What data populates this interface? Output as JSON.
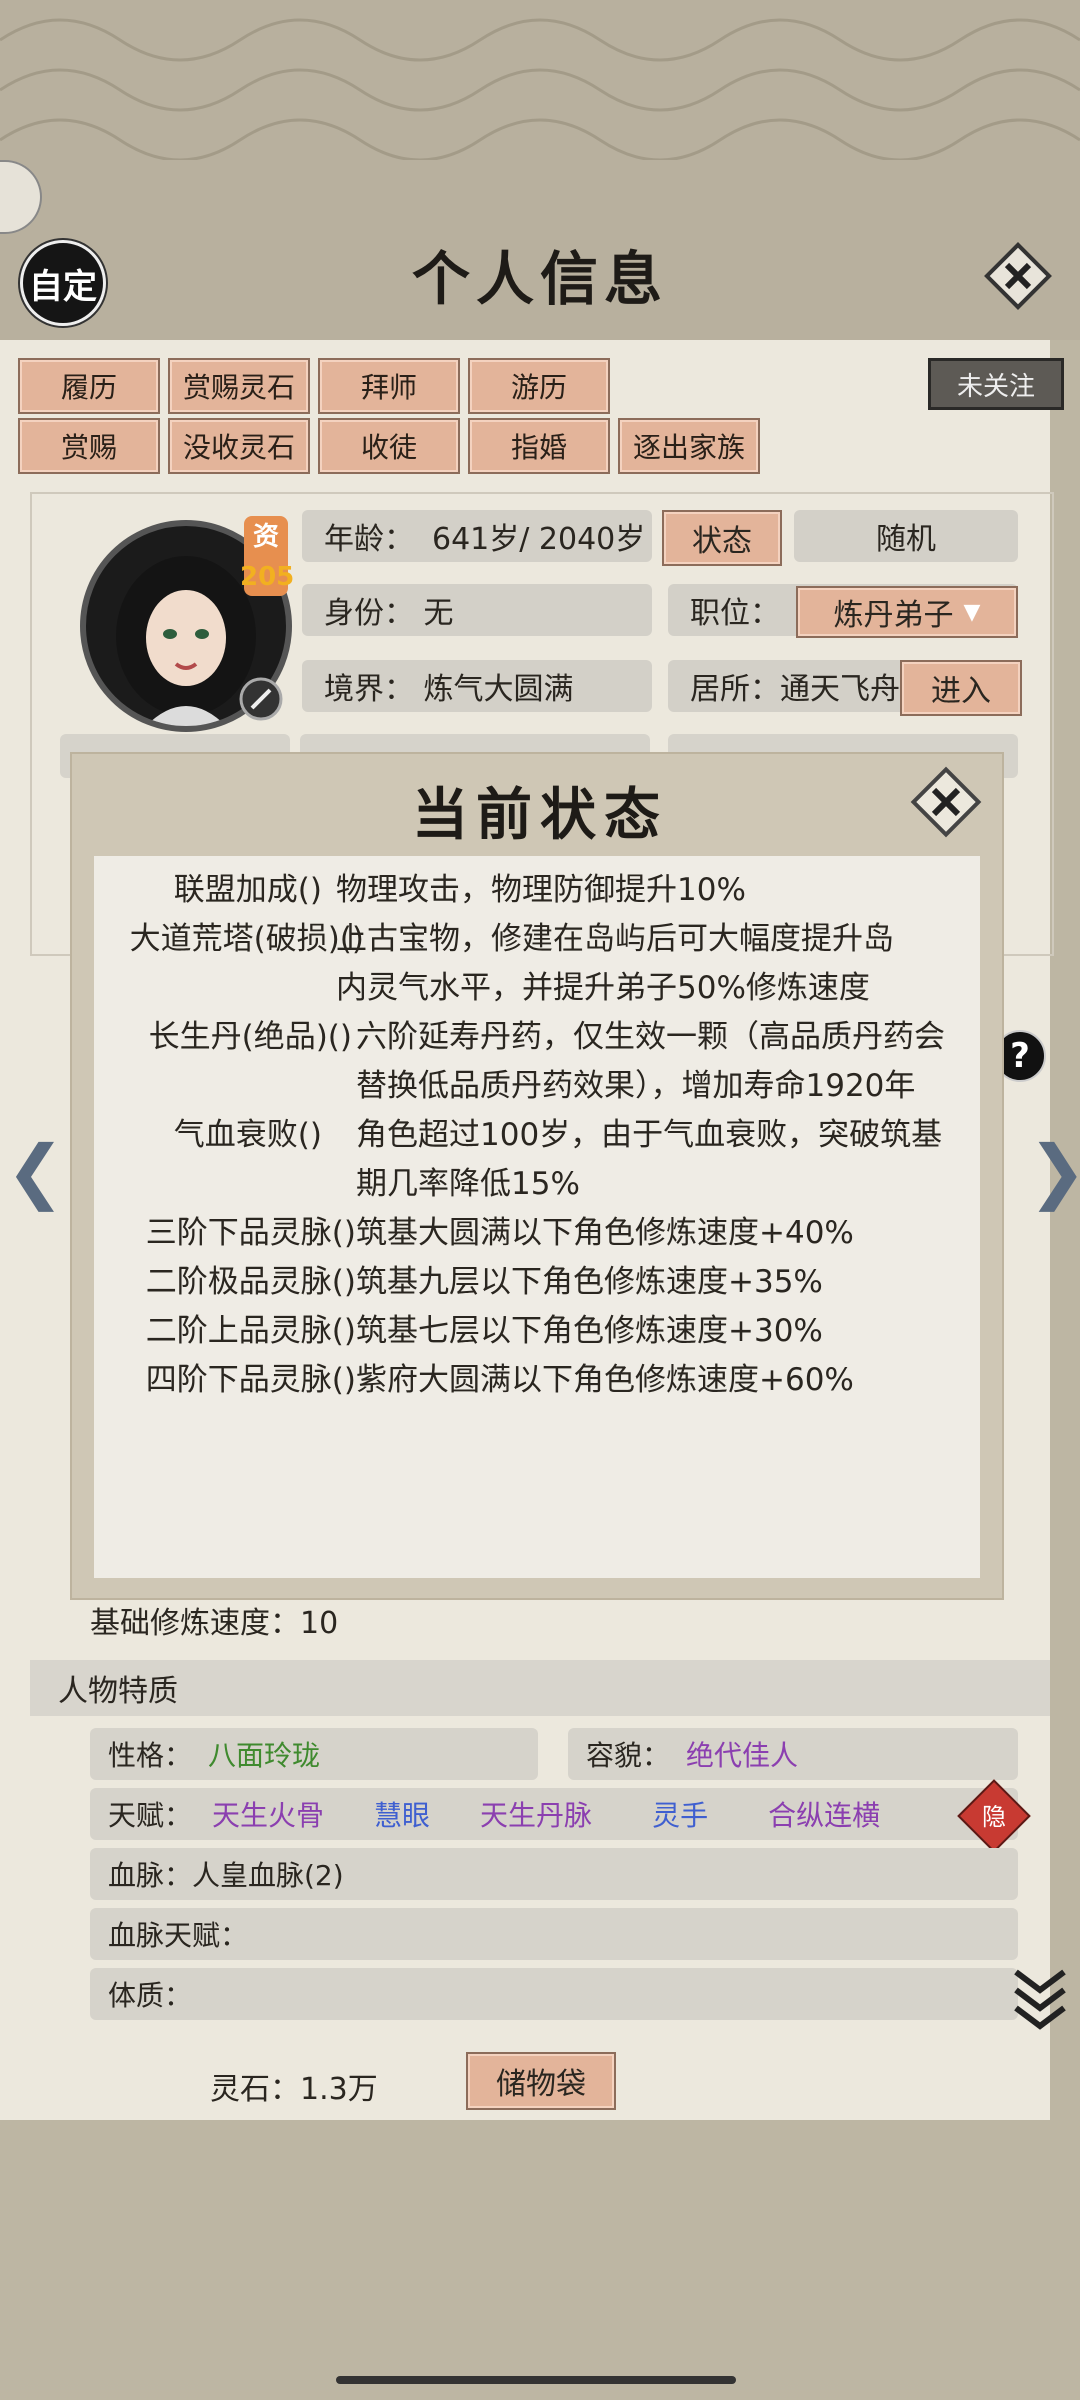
{
  "header": {
    "title": "个人信息",
    "auto_label": "自定"
  },
  "tabs_row1": [
    "履历",
    "赏赐灵石",
    "拜师",
    "游历"
  ],
  "tabs_row2": [
    "赏赐",
    "没收灵石",
    "收徒",
    "指婚",
    "逐出家族"
  ],
  "follow_label": "未关注",
  "profile": {
    "zi_label": "资",
    "zi_value": "205",
    "age_label": "年龄：",
    "age_value": "641岁/ 2040岁",
    "status_button": "状态",
    "random_button": "随机",
    "identity": "身份：  无",
    "position_label": "职位：",
    "position_value": "炼丹弟子",
    "realm": "境界：  炼气大圆满",
    "residence": "居所：通天飞舟",
    "enter_button": "进入"
  },
  "popup": {
    "title": "当前状态",
    "statuses": [
      {
        "name": "联盟加成()",
        "desc": "物理攻击，物理防御提升10%"
      },
      {
        "name": "大道荒塔(破损)()",
        "desc": "上古宝物，修建在岛屿后可大幅度提升岛内灵气水平，并提升弟子50%修炼速度"
      },
      {
        "name": "长生丹(绝品)()",
        "desc": "六阶延寿丹药，仅生效一颗（高品质丹药会替换低品质丹药效果），增加寿命1920年"
      },
      {
        "name": "气血衰败()",
        "desc": "角色超过100岁，由于气血衰败，突破筑基期几率降低15%"
      },
      {
        "name": "三阶下品灵脉()",
        "desc": "筑基大圆满以下角色修炼速度+40%"
      },
      {
        "name": "二阶极品灵脉()",
        "desc": "筑基九层以下角色修炼速度+35%"
      },
      {
        "name": "二阶上品灵脉()",
        "desc": "筑基七层以下角色修炼速度+30%"
      },
      {
        "name": "四阶下品灵脉()",
        "desc": "紫府大圆满以下角色修炼速度+60%"
      }
    ]
  },
  "base_speed": "基础修炼速度：10",
  "traits": {
    "section_title": "人物特质",
    "personality_label": "性格：",
    "personality_value": "八面玲珑",
    "looks_label": "容貌：",
    "looks_value": "绝代佳人",
    "talent_label": "天赋：",
    "talents": [
      "天生火骨",
      "慧眼",
      "天生丹脉",
      "灵手",
      "合纵连横"
    ],
    "hidden_badge": "隐",
    "bloodline": "血脉：人皇血脉(2)",
    "bloodline_talent": "血脉天赋：",
    "physique": "体质："
  },
  "footer": {
    "spirit_stones": "灵石：1.3万",
    "bag_button": "储物袋"
  },
  "help_icon": "?",
  "colors": {
    "tab_bg": "#e3b49a",
    "panel_bg": "#ece8dd",
    "popup_bg": "#cfc7b5",
    "green": "#3f8a2e",
    "purple": "#8b3fb0",
    "blue": "#3f5fd0"
  }
}
